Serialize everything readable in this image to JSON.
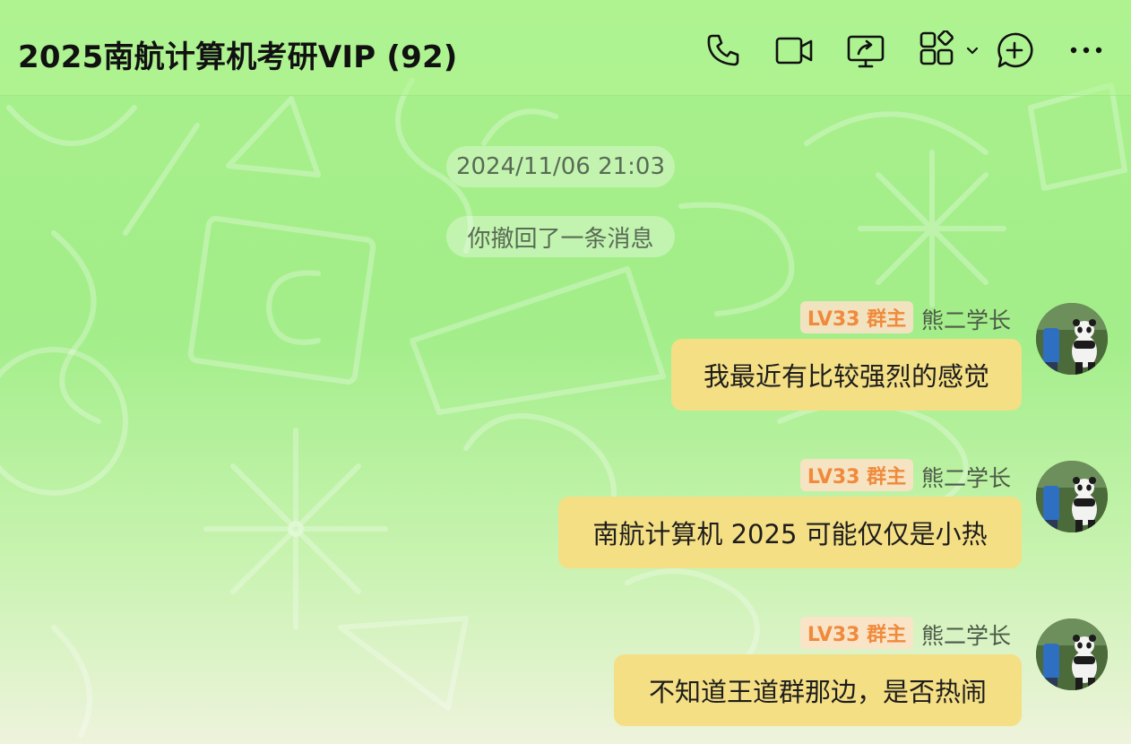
{
  "header": {
    "title": "2025南航计算机考研VIP (92)",
    "icons": [
      "phone-icon",
      "video-call-icon",
      "screen-share-icon",
      "apps-icon",
      "chevron-down-icon",
      "add-chat-icon",
      "more-icon"
    ]
  },
  "chat": {
    "timestamp": "2024/11/06 21:03",
    "system_notice": "你撤回了一条消息",
    "messages": [
      {
        "badge": "LV33 群主",
        "sender": "熊二学长",
        "text": "我最近有比较强烈的感觉"
      },
      {
        "badge": "LV33 群主",
        "sender": "熊二学长",
        "text": "南航计算机 2025 可能仅仅是小热"
      },
      {
        "badge": "LV33 群主",
        "sender": "熊二学长",
        "text": "不知道王道群那边，是否热闹"
      }
    ]
  },
  "colors": {
    "background": "#a8f08c",
    "bubble": "#f5df84",
    "badge_text": "#f08a3c",
    "badge_bg": "#ffe1c8"
  }
}
